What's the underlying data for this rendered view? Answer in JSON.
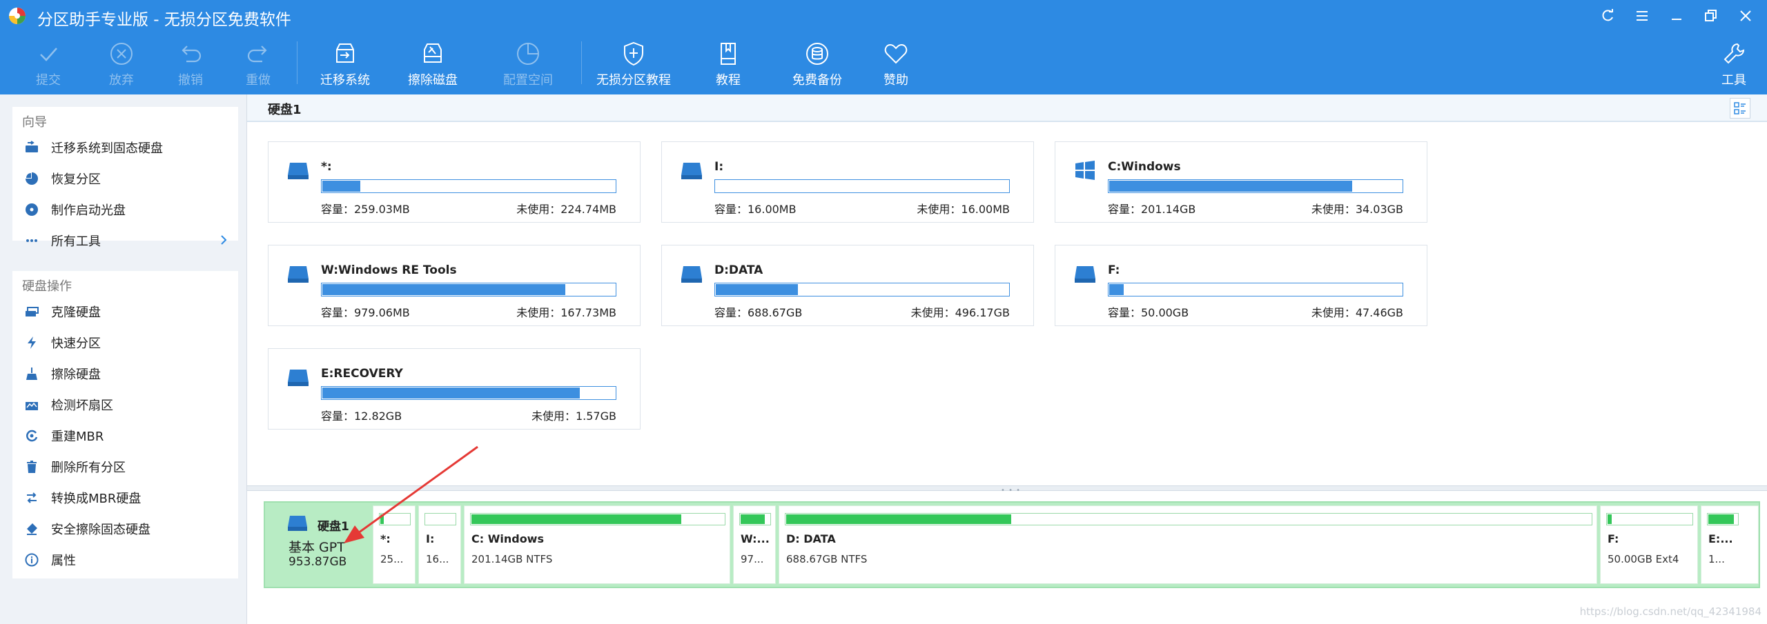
{
  "window": {
    "title": "分区助手专业版 - 无损分区免费软件"
  },
  "toolbar": {
    "items": [
      {
        "label": "提交",
        "icon": "check-icon",
        "disabled": true
      },
      {
        "label": "放弃",
        "icon": "cancel-circle-icon",
        "disabled": true
      },
      {
        "label": "撤销",
        "icon": "undo-icon",
        "disabled": true
      },
      {
        "label": "重做",
        "icon": "redo-icon",
        "disabled": true
      },
      {
        "label": "迁移系统",
        "icon": "migrate-disk-icon",
        "disabled": false
      },
      {
        "label": "擦除磁盘",
        "icon": "wipe-disk-icon",
        "disabled": false
      },
      {
        "label": "配置空间",
        "icon": "allocate-space-icon",
        "disabled": true
      },
      {
        "label": "无损分区教程",
        "icon": "shield-icon",
        "disabled": false
      },
      {
        "label": "教程",
        "icon": "book-icon",
        "disabled": false
      },
      {
        "label": "免费备份",
        "icon": "backup-icon",
        "disabled": false
      },
      {
        "label": "赞助",
        "icon": "heart-icon",
        "disabled": false
      }
    ],
    "tools_label": "工具"
  },
  "sidebar": {
    "wizard": {
      "heading": "向导",
      "items": [
        {
          "label": "迁移系统到固态硬盘",
          "icon": "migrate-ssd-icon"
        },
        {
          "label": "恢复分区",
          "icon": "recover-partition-icon"
        },
        {
          "label": "制作启动光盘",
          "icon": "boot-disc-icon"
        },
        {
          "label": "所有工具",
          "icon": "more-dots-icon"
        }
      ]
    },
    "disk_ops": {
      "heading": "硬盘操作",
      "items": [
        {
          "label": "克隆硬盘",
          "icon": "clone-disk-icon"
        },
        {
          "label": "快速分区",
          "icon": "lightning-icon"
        },
        {
          "label": "擦除硬盘",
          "icon": "wipe-broom-icon"
        },
        {
          "label": "检测坏扇区",
          "icon": "bad-sector-icon"
        },
        {
          "label": "重建MBR",
          "icon": "rebuild-mbr-icon"
        },
        {
          "label": "删除所有分区",
          "icon": "trash-icon"
        },
        {
          "label": "转换成MBR硬盘",
          "icon": "convert-icon"
        },
        {
          "label": "安全擦除固态硬盘",
          "icon": "eraser-icon"
        },
        {
          "label": "属性",
          "icon": "info-icon"
        }
      ]
    }
  },
  "main": {
    "disk_title": "硬盘1",
    "partitions": [
      {
        "name": "*:",
        "capacity": "容量：259.03MB",
        "free": "未使用：224.74MB",
        "used_fraction": 0.13,
        "icon": "drive-icon"
      },
      {
        "name": "I:",
        "capacity": "容量：16.00MB",
        "free": "未使用：16.00MB",
        "used_fraction": 0.0,
        "icon": "drive-icon"
      },
      {
        "name": "C:Windows",
        "capacity": "容量：201.14GB",
        "free": "未使用：34.03GB",
        "used_fraction": 0.83,
        "icon": "windows-icon"
      },
      {
        "name": "W:Windows RE Tools",
        "capacity": "容量：979.06MB",
        "free": "未使用：167.73MB",
        "used_fraction": 0.83,
        "icon": "drive-icon"
      },
      {
        "name": "D:DATA",
        "capacity": "容量：688.67GB",
        "free": "未使用：496.17GB",
        "used_fraction": 0.28,
        "icon": "drive-icon"
      },
      {
        "name": "F:",
        "capacity": "容量：50.00GB",
        "free": "未使用：47.46GB",
        "used_fraction": 0.05,
        "icon": "drive-icon"
      },
      {
        "name": "E:RECOVERY",
        "capacity": "容量：12.82GB",
        "free": "未使用：1.57GB",
        "used_fraction": 0.88,
        "icon": "drive-icon"
      }
    ]
  },
  "diskmap": {
    "disk_name": "硬盘1",
    "disk_type": "基本 GPT",
    "disk_size": "953.87GB",
    "partitions": [
      {
        "name": "*:",
        "info": "25...",
        "used_fraction": 0.13
      },
      {
        "name": "I:",
        "info": "16...",
        "used_fraction": 0.0
      },
      {
        "name": "C: Windows",
        "info": "201.14GB NTFS",
        "used_fraction": 0.83
      },
      {
        "name": "W:...",
        "info": "97...",
        "used_fraction": 0.83
      },
      {
        "name": "D: DATA",
        "info": "688.67GB NTFS",
        "used_fraction": 0.28
      },
      {
        "name": "F:",
        "info": "50.00GB Ext4",
        "used_fraction": 0.05
      },
      {
        "name": "E:...",
        "info": "1...",
        "used_fraction": 0.88
      }
    ]
  },
  "watermark": "https://blog.csdn.net/qq_42341984",
  "colors": {
    "titlebar": "#2d8ae3",
    "card_bar": "#3d8fe0",
    "diskmap_bg": "#b8ecc4",
    "partition_fill": "#34c759",
    "arrow": "#e53935"
  }
}
